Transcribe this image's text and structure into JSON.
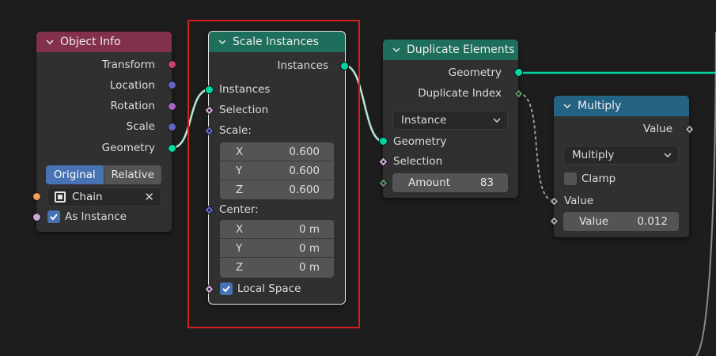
{
  "colors": {
    "geometry": "#00d6a3",
    "vector": "#6363c7",
    "rotation": "#a663c7",
    "matrix": "#c7407a",
    "float": "#a1a1a1",
    "int": "#598c5c",
    "bool": "#cca6d6",
    "object": "#ed9e5c",
    "header_object_info": "#83314a",
    "header_geometry": "#1e6e5c",
    "header_function": "#246283"
  },
  "object_info": {
    "title": "Object Info",
    "outputs": [
      "Transform",
      "Location",
      "Rotation",
      "Scale",
      "Geometry"
    ],
    "toggle_original": "Original",
    "toggle_relative": "Relative",
    "object_value": "Chain",
    "as_instance_label": "As Instance"
  },
  "scale_instances": {
    "title": "Scale Instances",
    "output_instances": "Instances",
    "input_instances": "Instances",
    "input_selection": "Selection",
    "scale_label": "Scale:",
    "scale": [
      {
        "axis": "X",
        "value": "0.600"
      },
      {
        "axis": "Y",
        "value": "0.600"
      },
      {
        "axis": "Z",
        "value": "0.600"
      }
    ],
    "center_label": "Center:",
    "center": [
      {
        "axis": "X",
        "value": "0 m"
      },
      {
        "axis": "Y",
        "value": "0 m"
      },
      {
        "axis": "Z",
        "value": "0 m"
      }
    ],
    "local_space_label": "Local Space"
  },
  "duplicate_elements": {
    "title": "Duplicate Elements",
    "output_geometry": "Geometry",
    "output_duplicate_index": "Duplicate Index",
    "domain_value": "Instance",
    "input_geometry": "Geometry",
    "input_selection": "Selection",
    "amount_label": "Amount",
    "amount_value": "83"
  },
  "multiply": {
    "title": "Multiply",
    "output_value": "Value",
    "operation_value": "Multiply",
    "clamp_label": "Clamp",
    "input_value_label": "Value",
    "value_field_label": "Value",
    "value_field_value": "0.012"
  }
}
